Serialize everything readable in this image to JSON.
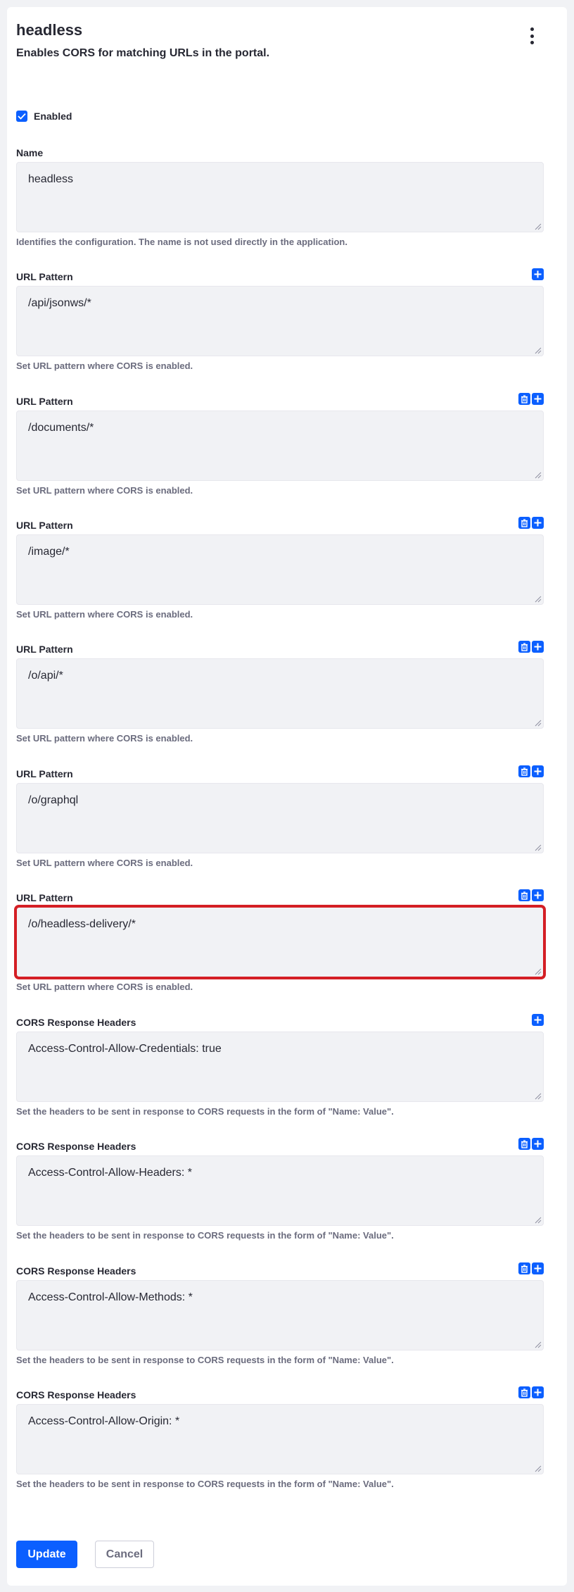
{
  "header": {
    "title": "headless",
    "description": "Enables CORS for matching URLs in the portal."
  },
  "enabled": {
    "label": "Enabled",
    "checked": true
  },
  "name_field": {
    "label": "Name",
    "value": "headless",
    "help": "Identifies the configuration. The name is not used directly in the application."
  },
  "url_patterns": [
    {
      "label": "URL Pattern",
      "value": "/api/jsonws/*",
      "help": "Set URL pattern where CORS is enabled."
    },
    {
      "label": "URL Pattern",
      "value": "/documents/*",
      "help": "Set URL pattern where CORS is enabled."
    },
    {
      "label": "URL Pattern",
      "value": "/image/*",
      "help": "Set URL pattern where CORS is enabled."
    },
    {
      "label": "URL Pattern",
      "value": "/o/api/*",
      "help": "Set URL pattern where CORS is enabled."
    },
    {
      "label": "URL Pattern",
      "value": "/o/graphql",
      "help": "Set URL pattern where CORS is enabled."
    },
    {
      "label": "URL Pattern",
      "value": "/o/headless-delivery/*",
      "help": "Set URL pattern where CORS is enabled."
    }
  ],
  "cors_headers": [
    {
      "label": "CORS Response Headers",
      "value": "Access-Control-Allow-Credentials: true",
      "help": "Set the headers to be sent in response to CORS requests in the form of \"Name: Value\"."
    },
    {
      "label": "CORS Response Headers",
      "value": "Access-Control-Allow-Headers: *",
      "help": "Set the headers to be sent in response to CORS requests in the form of \"Name: Value\"."
    },
    {
      "label": "CORS Response Headers",
      "value": "Access-Control-Allow-Methods: *",
      "help": "Set the headers to be sent in response to CORS requests in the form of \"Name: Value\"."
    },
    {
      "label": "CORS Response Headers",
      "value": "Access-Control-Allow-Origin: *",
      "help": "Set the headers to be sent in response to CORS requests in the form of \"Name: Value\"."
    }
  ],
  "buttons": {
    "update": "Update",
    "cancel": "Cancel"
  },
  "colors": {
    "accent": "#0b5fff",
    "highlight": "#d41f25",
    "field_bg": "#f1f2f5",
    "help_text": "#6b6c7e"
  }
}
